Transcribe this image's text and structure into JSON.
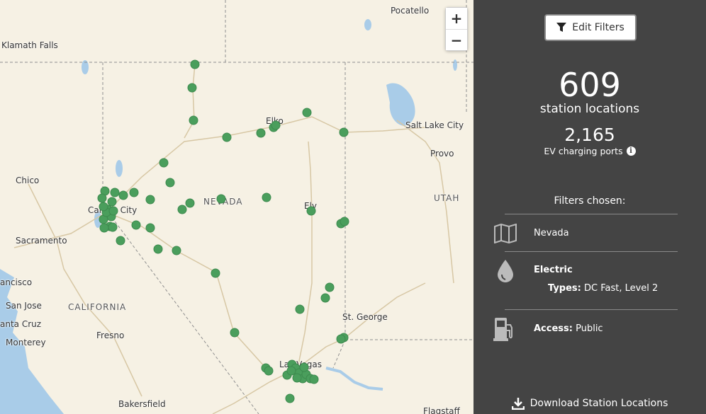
{
  "map": {
    "zoom_in_label": "+",
    "zoom_out_label": "−",
    "marker_color": "#4a9e5c",
    "place_labels": [
      {
        "id": "pocatello",
        "text": "Pocatello"
      },
      {
        "id": "klamath",
        "text": "Klamath Falls"
      },
      {
        "id": "elko",
        "text": "Elko"
      },
      {
        "id": "slc",
        "text": "Salt Lake City"
      },
      {
        "id": "provo",
        "text": "Provo"
      },
      {
        "id": "chico",
        "text": "Chico"
      },
      {
        "id": "nevada",
        "text": "NEVADA"
      },
      {
        "id": "carson",
        "text": "Carson City"
      },
      {
        "id": "ely",
        "text": "Ely"
      },
      {
        "id": "utah",
        "text": "UTAH"
      },
      {
        "id": "sacramento",
        "text": "Sacramento"
      },
      {
        "id": "sf",
        "text": "ancisco"
      },
      {
        "id": "sanjose",
        "text": "San Jose"
      },
      {
        "id": "california",
        "text": "CALIFORNIA"
      },
      {
        "id": "stgeorge",
        "text": "St. George"
      },
      {
        "id": "santacruz",
        "text": "anta Cruz"
      },
      {
        "id": "fresno",
        "text": "Fresno"
      },
      {
        "id": "monterey",
        "text": "Monterey"
      },
      {
        "id": "lasvegas",
        "text": "Las Vegas"
      },
      {
        "id": "bakersfield",
        "text": "Bakersfield"
      },
      {
        "id": "flagstaff",
        "text": "Flagstaff"
      }
    ]
  },
  "panel": {
    "edit_filters_label": "Edit Filters",
    "station_count": "609",
    "station_label": "station locations",
    "port_count": "2,165",
    "port_label": "EV charging ports",
    "filters_title": "Filters chosen:",
    "state_filter": "Nevada",
    "fuel_label": "Electric",
    "types_label": "Types:",
    "types_value": "DC Fast, Level 2",
    "access_label": "Access:",
    "access_value": "Public",
    "download_label": "Download Station Locations"
  }
}
